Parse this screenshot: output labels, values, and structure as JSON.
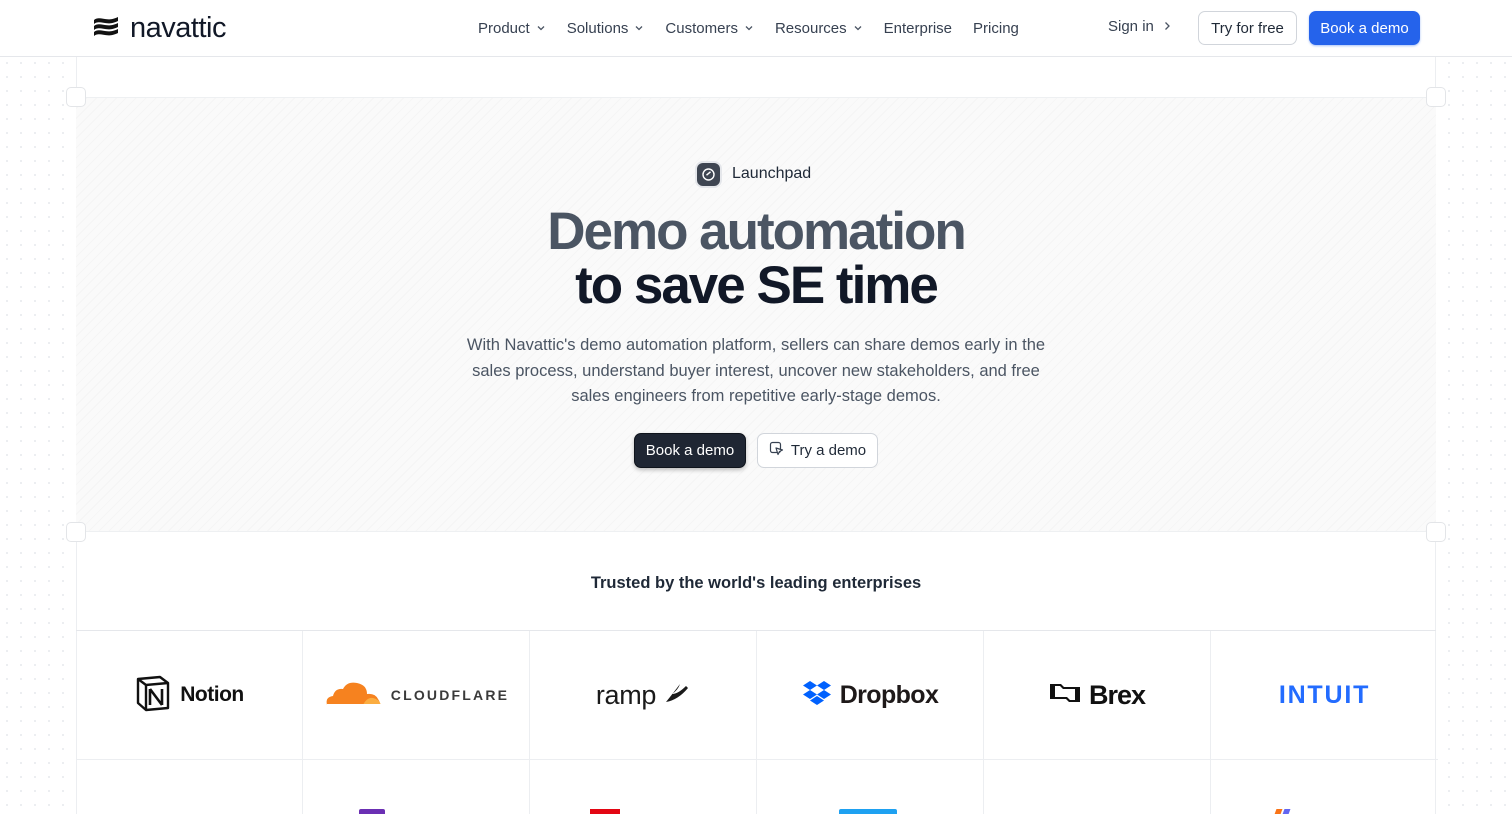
{
  "brand": {
    "name": "navattic",
    "icon": "navattic-logo-icon"
  },
  "nav": {
    "items": [
      {
        "label": "Product",
        "has_dropdown": true
      },
      {
        "label": "Solutions",
        "has_dropdown": true
      },
      {
        "label": "Customers",
        "has_dropdown": true
      },
      {
        "label": "Resources",
        "has_dropdown": true
      },
      {
        "label": "Enterprise",
        "has_dropdown": false
      },
      {
        "label": "Pricing",
        "has_dropdown": false
      }
    ],
    "sign_in": "Sign in",
    "try_free": "Try for free",
    "book_demo": "Book a demo"
  },
  "hero": {
    "badge": "Launchpad",
    "badge_icon": "launchpad-icon",
    "headline_line1": "Demo automation",
    "headline_line2": "to save SE time",
    "subcopy": "With Navattic's demo automation platform, sellers can share demos early in the sales process, understand buyer interest, uncover new stakeholders, and free sales engineers from repetitive early-stage demos.",
    "cta_primary": "Book a demo",
    "cta_secondary": "Try a demo",
    "cta_secondary_icon": "cursor-click-icon"
  },
  "trusted": {
    "heading": "Trusted by the world's leading enterprises",
    "logos": [
      "Notion",
      "CLOUDFLARE",
      "ramp",
      "Dropbox",
      "Brex",
      "INTUIT"
    ]
  },
  "colors": {
    "accent": "#2563eb",
    "dark_button": "#1f2633",
    "cloudflare_orange": "#f6821f",
    "dropbox_blue": "#0061fe",
    "intuit_blue": "#236cff"
  }
}
